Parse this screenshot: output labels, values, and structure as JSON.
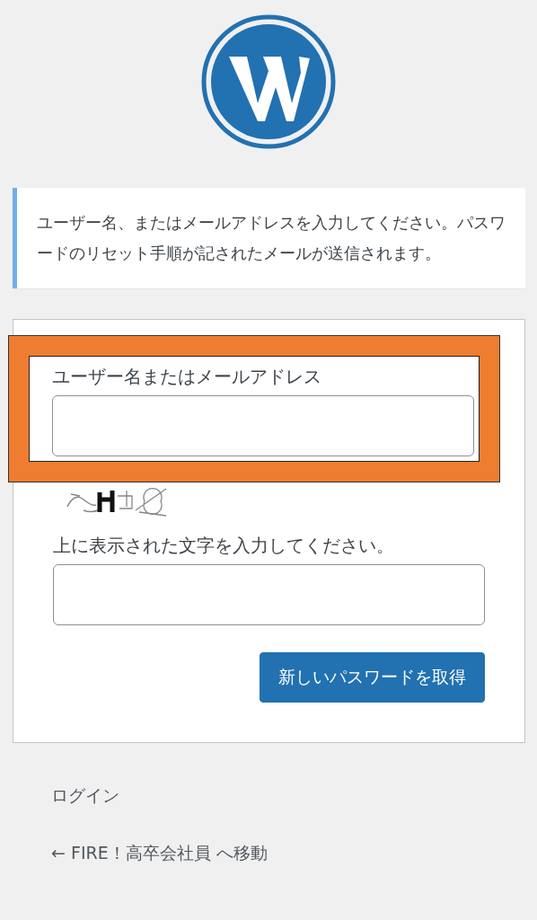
{
  "notice": "ユーザー名、またはメールアドレスを入力してください。パスワードのリセット手順が記されたメールが送信されます。",
  "form": {
    "fields": [
      {
        "kind": "text",
        "label": "ユーザー名またはメールアドレス",
        "highlighted": true
      },
      {
        "kind": "captcha",
        "label": "上に表示された文字を入力してください。",
        "highlighted": false
      }
    ],
    "submit": "新しいパスワードを取得"
  },
  "links": [
    "ログイン",
    "← FIRE！高卒会社員 へ移動"
  ]
}
